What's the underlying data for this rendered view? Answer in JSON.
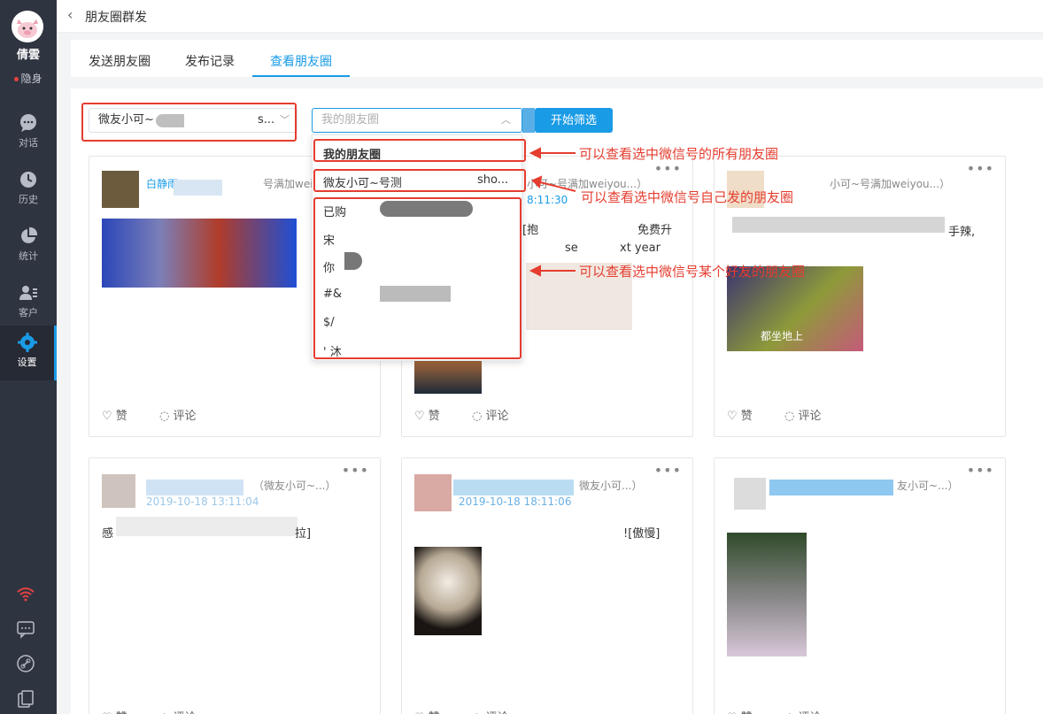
{
  "sidebar": {
    "user_name": "倩雲",
    "user_status": "隐身",
    "items": [
      {
        "label": "对话",
        "icon": "chat-icon"
      },
      {
        "label": "历史",
        "icon": "clock-icon"
      },
      {
        "label": "统计",
        "icon": "pie-chart-icon"
      },
      {
        "label": "客户",
        "icon": "contacts-icon"
      },
      {
        "label": "设置",
        "icon": "gear-icon"
      }
    ],
    "bottom_icons": [
      "wifi-icon",
      "feedback-icon",
      "link-icon",
      "copy-icon"
    ]
  },
  "header": {
    "title": "朋友圈群发",
    "back_icon": "chevron-left-icon"
  },
  "tabs": [
    {
      "label": "发送朋友圈",
      "active": false
    },
    {
      "label": "发布记录",
      "active": false
    },
    {
      "label": "查看朋友圈",
      "active": true
    }
  ],
  "filter": {
    "account_select_value": "微友小可~",
    "account_select_suffix": "s...",
    "moments_select_placeholder": "我的朋友圈",
    "start_button": "开始筛选"
  },
  "dropdown": {
    "items": [
      "我的朋友圈",
      "微友小可~号测",
      "已购",
      "宋",
      "你",
      "#&",
      "$/",
      "' 沐"
    ],
    "item2_suffix": "sho..."
  },
  "annotations": [
    "可以查看选中微信号的所有朋友圈",
    "可以查看选中微信号自己发的朋友圈",
    "可以查看选中微信号某个好友的朋友圈"
  ],
  "cards": [
    {
      "name": "白静雨",
      "account": "号满加weiyou...）",
      "text": "",
      "time": "",
      "like": "赞",
      "comment": "评论"
    },
    {
      "name": "",
      "account": "小可~号满加weiyou...）",
      "time": "8:11:30",
      "text": "[抱",
      "text2": "免费升",
      "text3": "se",
      "text4": "xt year",
      "like": "赞",
      "comment": "评论"
    },
    {
      "name": "",
      "account": "小可~号满加weiyou...）",
      "text": "手辣,",
      "overlay": "都坐地上",
      "like": "赞",
      "comment": "评论"
    },
    {
      "name": "",
      "account": "（微友小可~...）",
      "time": "2019-10-18 13:11:04",
      "text": "感",
      "text_end": "拉]",
      "like": "赞",
      "comment": "评论"
    },
    {
      "name": "",
      "account": "微友小可...）",
      "time": "2019-10-18 18:11:06",
      "text": "![傲慢]",
      "like": "赞",
      "comment": "评论"
    },
    {
      "name": "",
      "account": "友小可~...）",
      "text": "",
      "like": "赞",
      "comment": "评论"
    }
  ]
}
